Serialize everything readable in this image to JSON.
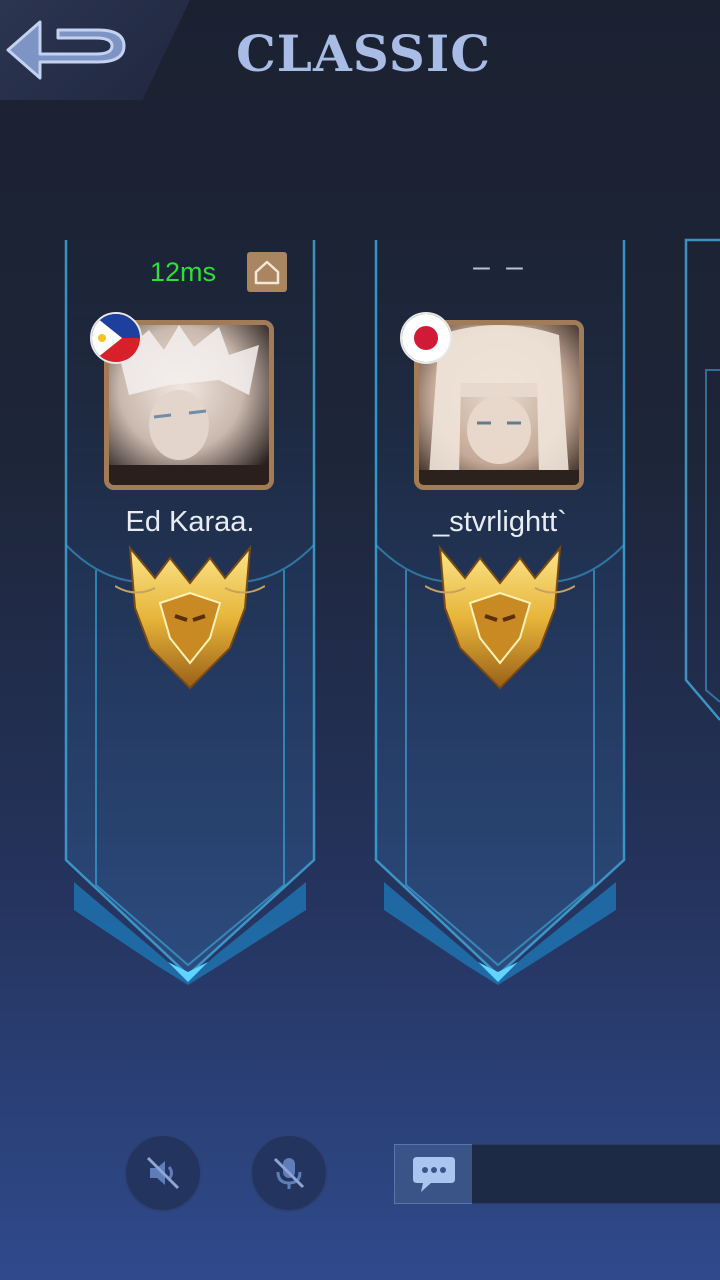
{
  "header": {
    "back_icon": "back-arrow-icon",
    "title": "CLASSIC"
  },
  "players": [
    {
      "ping": "12ms",
      "status_icon": "home-icon",
      "flag": "philippines-flag-icon",
      "name": "Ed Karaa.",
      "rank_icon": "mythic-rank-badge-icon"
    },
    {
      "ping": "– –",
      "flag": "japan-flag-icon",
      "name": "_stvrlightt`",
      "rank_icon": "mythic-rank-badge-icon"
    }
  ],
  "controls": {
    "speaker_icon": "speaker-muted-icon",
    "mic_icon": "mic-muted-icon",
    "chat_icon": "chat-bubble-icon"
  },
  "colors": {
    "title": "#a9bce6",
    "ping_good": "#2ede3a",
    "frame": "#3fa6d8",
    "avatar_border": "#a27c56",
    "rank_gold": "#e7b53a"
  }
}
